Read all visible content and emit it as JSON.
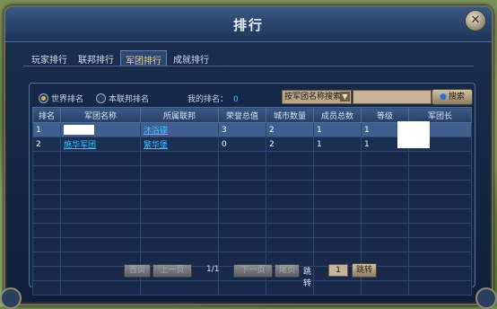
{
  "window": {
    "title": "排行",
    "close_glyph": "✕"
  },
  "tabs": [
    "玩家排行",
    "联邦排行",
    "军团排行",
    "成就排行"
  ],
  "active_tab": 2,
  "filter": {
    "radio_world": "世界排名",
    "radio_federation": "本联邦排名",
    "my_rank_label": "我的排名：",
    "my_rank_value": "0",
    "search_select": "按军团名称搜索",
    "search_button": "搜索"
  },
  "table": {
    "columns": [
      "排名",
      "军团名称",
      "所属联邦",
      "荣誉总值",
      "城市数量",
      "成员总数",
      "等级",
      "军团长"
    ],
    "rows": [
      {
        "rank": "1",
        "legion": "",
        "federation": "沐浴碟",
        "honor": "3",
        "cities": "2",
        "members": "1",
        "level": "1"
      },
      {
        "rank": "2",
        "legion": "施华军团",
        "federation": "繁华堡",
        "honor": "0",
        "cities": "2",
        "members": "1",
        "level": "1"
      }
    ]
  },
  "pager": {
    "first": "首页",
    "prev": "上一页",
    "page_info": "1/1",
    "next": "下一页",
    "last": "尾页",
    "jump_label": "跳转",
    "jump_value": "1",
    "jump_button": "跳转"
  }
}
